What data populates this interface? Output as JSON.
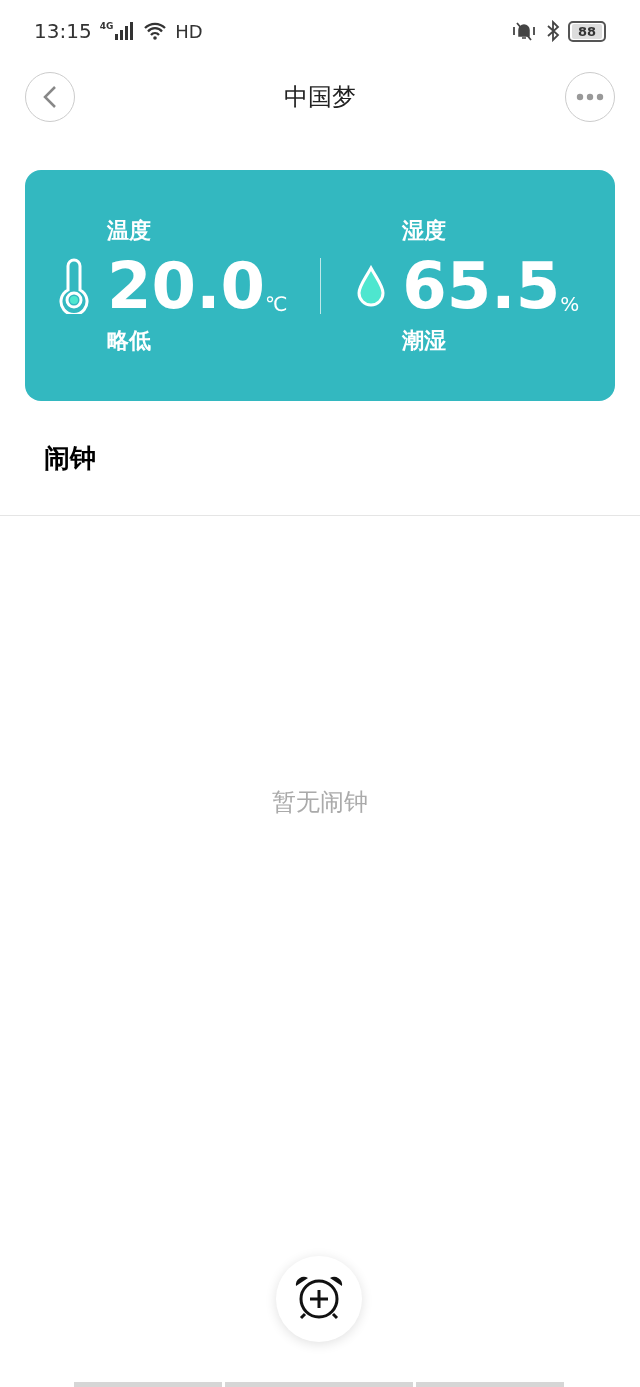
{
  "status_bar": {
    "time": "13:15",
    "network": "4G",
    "hd": "HD",
    "battery": "88"
  },
  "header": {
    "title": "中国梦"
  },
  "metrics": [
    {
      "kind": "temperature",
      "label": "温度",
      "value": "20.0",
      "unit": "℃",
      "status": "略低"
    },
    {
      "kind": "humidity",
      "label": "湿度",
      "value": "65.5",
      "unit": "%",
      "status": "潮湿"
    }
  ],
  "alarms": {
    "title": "闹钟",
    "empty_text": "暂无闹钟"
  }
}
